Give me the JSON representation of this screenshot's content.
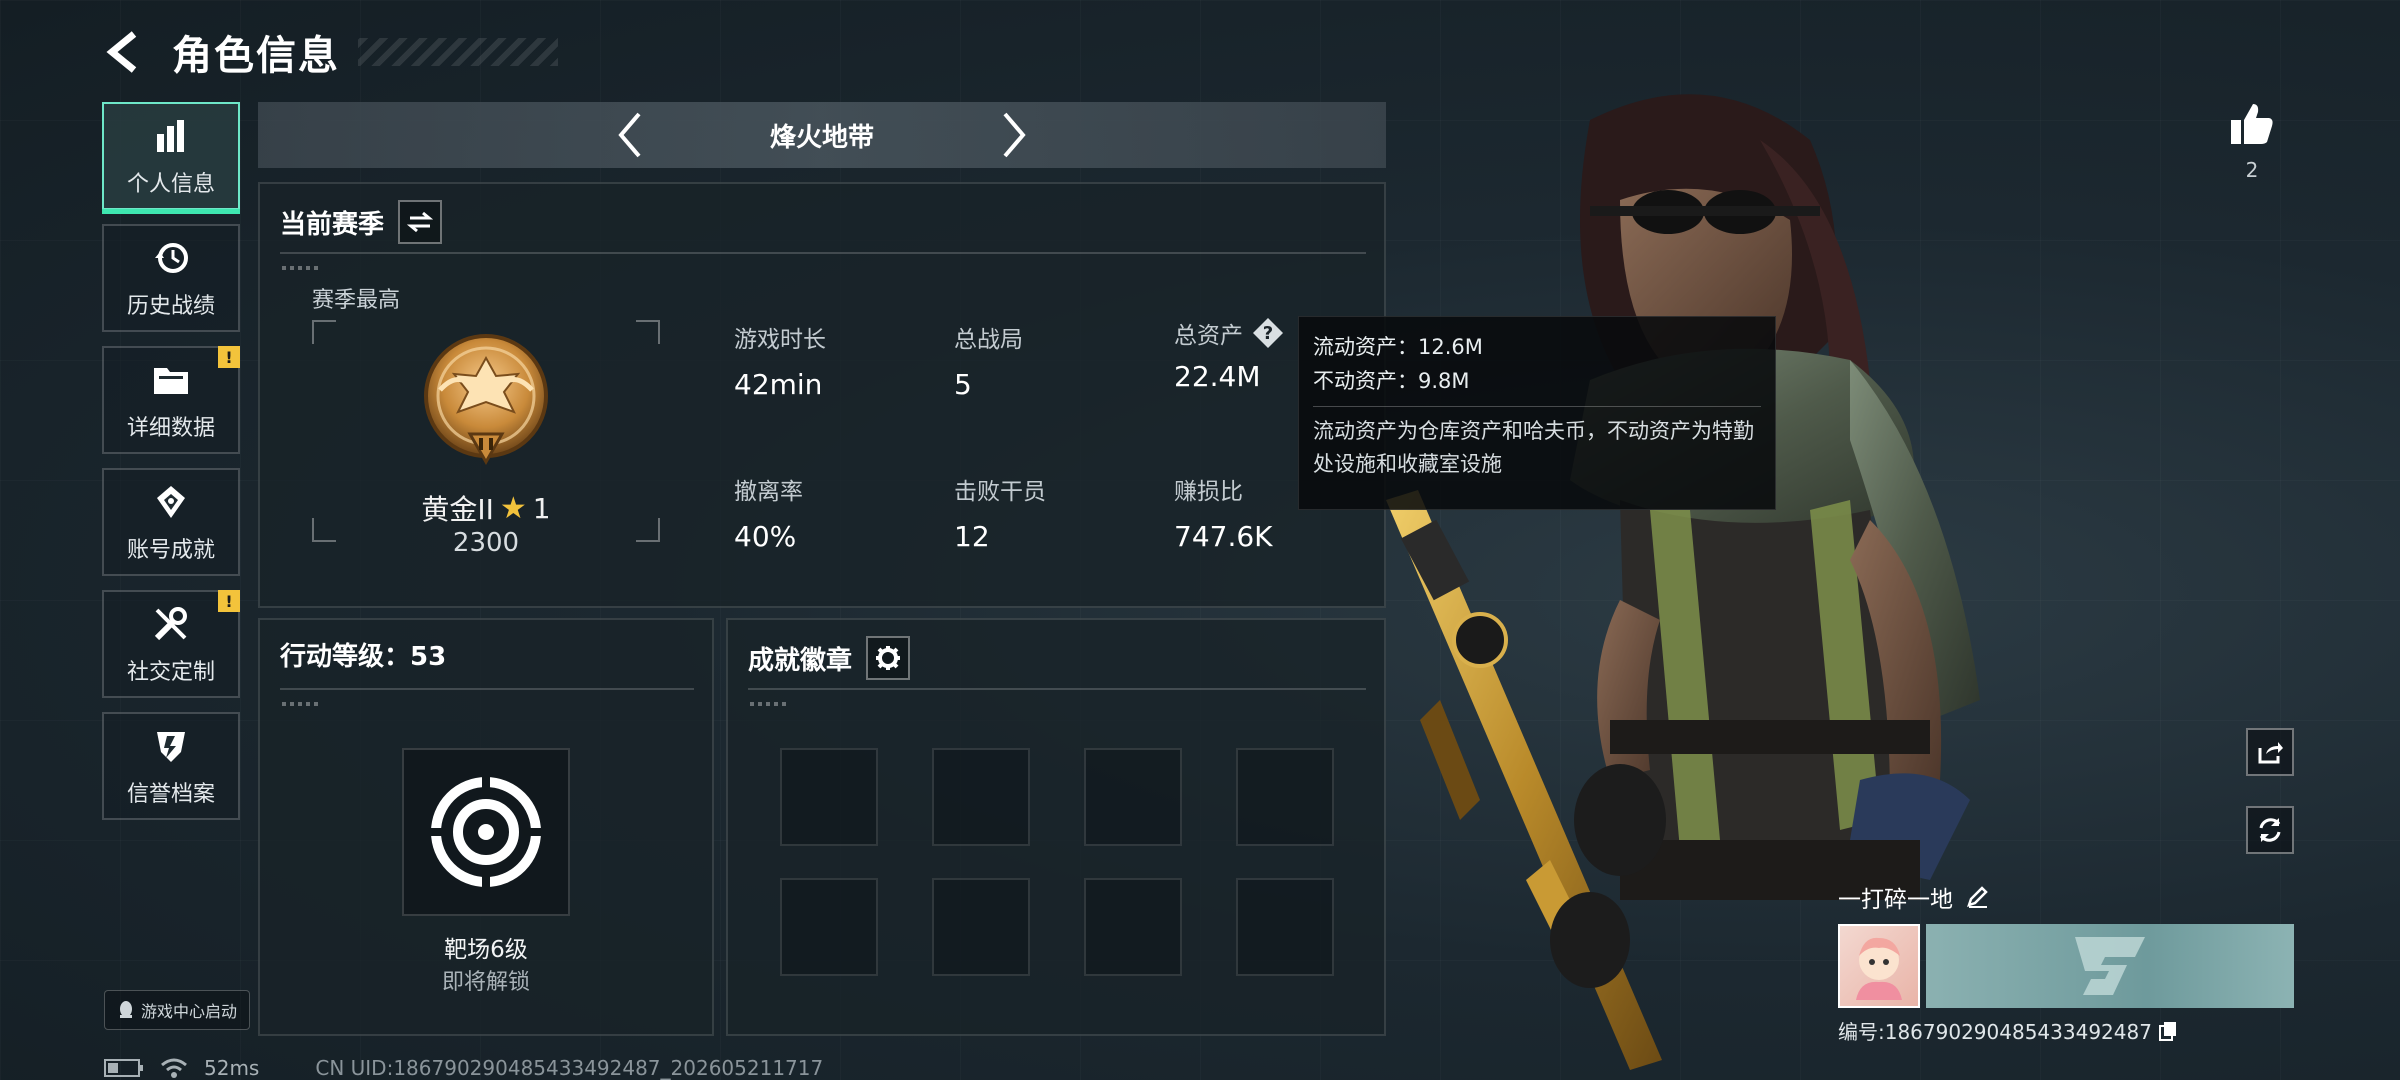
{
  "header": {
    "title": "角色信息"
  },
  "sidebar": {
    "items": [
      {
        "label": "个人信息",
        "icon": "bar-chart-icon",
        "active": true,
        "alert": false
      },
      {
        "label": "历史战绩",
        "icon": "history-clock-icon",
        "active": false,
        "alert": false
      },
      {
        "label": "详细数据",
        "icon": "folder-icon",
        "active": false,
        "alert": true
      },
      {
        "label": "账号成就",
        "icon": "achievement-icon",
        "active": false,
        "alert": false
      },
      {
        "label": "社交定制",
        "icon": "wrench-icon",
        "active": false,
        "alert": true
      },
      {
        "label": "信誉档案",
        "icon": "shield-icon",
        "active": false,
        "alert": false
      }
    ],
    "alert_symbol": "!",
    "game_center_label": "游戏中心启动"
  },
  "mode": {
    "name": "烽火地带"
  },
  "season": {
    "title": "当前赛季",
    "best_label": "赛季最高",
    "rank_name": "黄金II",
    "rank_star": "★",
    "rank_stars": "1",
    "rank_score": "2300",
    "stats": [
      {
        "label": "游戏时长",
        "value": "42min"
      },
      {
        "label": "总战局",
        "value": "5"
      },
      {
        "label": "总资产",
        "value": "22.4M"
      },
      {
        "label": "撤离率",
        "value": "40%"
      },
      {
        "label": "击败干员",
        "value": "12"
      },
      {
        "label": "赚损比",
        "value": "747.6K"
      }
    ]
  },
  "tooltip": {
    "liquid": "流动资产：12.6M",
    "fixed": "不动资产：9.8M",
    "description": "流动资产为仓库资产和哈夫币，不动资产为特勤处设施和收藏室设施"
  },
  "level": {
    "title": "行动等级：53",
    "target_name": "靶场6级",
    "target_status": "即将解锁"
  },
  "badges": {
    "title": "成就徽章",
    "slot_count": 8
  },
  "social": {
    "like_count": "2"
  },
  "player": {
    "name": "一打碎一地",
    "id_text": "编号:186790290485433492487"
  },
  "status": {
    "ping": "52ms",
    "uid": "CN UID:186790290485433492487_202605211717"
  },
  "colors": {
    "accent": "#3ee7b0",
    "alert": "#f3c33b",
    "gold": "#c98a3a",
    "banner": "#7ea6a7"
  }
}
